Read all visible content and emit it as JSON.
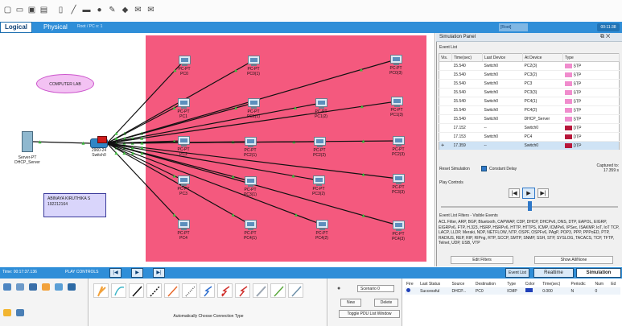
{
  "workspace": {
    "logical_tab": "Logical",
    "physical_tab": "Physical",
    "breadcrumb": "Root / PC o: 1",
    "root_label": "[Root]",
    "time_readout": "00:11:38"
  },
  "canvas": {
    "notes": {
      "lab": "COMPUTER LAB",
      "name_line1": "ABINAYA KIRUTHIKA S",
      "name_line2": "192212164"
    },
    "server": {
      "line1": "Server-PT",
      "line2": "DHCP_Server"
    },
    "switch": {
      "line1": "2960-24",
      "line2": "Switch0"
    },
    "pcs": [
      {
        "type": "PC-PT",
        "name": "PC0"
      },
      {
        "type": "PC-PT",
        "name": "PC0(1)"
      },
      {
        "type": "PC-PT",
        "name": "PC0(3)"
      },
      {
        "type": "PC-PT",
        "name": "PC1"
      },
      {
        "type": "PC-PT",
        "name": "PC1(1)"
      },
      {
        "type": "PC-PT",
        "name": "PC1(2)"
      },
      {
        "type": "PC-PT",
        "name": "PC1(3)"
      },
      {
        "type": "PC-PT",
        "name": "PC2"
      },
      {
        "type": "PC-PT",
        "name": "PC2(1)"
      },
      {
        "type": "PC-PT",
        "name": "PC2(2)"
      },
      {
        "type": "PC-PT",
        "name": "PC2(3)"
      },
      {
        "type": "PC-PT",
        "name": "PC3"
      },
      {
        "type": "PC-PT",
        "name": "PC3(1)"
      },
      {
        "type": "PC-PT",
        "name": "PC3(2)"
      },
      {
        "type": "PC-PT",
        "name": "PC3(3)"
      },
      {
        "type": "PC-PT",
        "name": "PC4"
      },
      {
        "type": "PC-PT",
        "name": "PC4(1)"
      },
      {
        "type": "PC-PT",
        "name": "PC4(2)"
      },
      {
        "type": "PC-PT",
        "name": "PC4(3)"
      }
    ],
    "cluster_color": "#f4597e"
  },
  "sim_panel": {
    "title": "Simulation Panel",
    "event_list_label": "Event List",
    "columns": [
      "Vis.",
      "Time(sec)",
      "Last Device",
      "At Device",
      "Type"
    ],
    "events": [
      {
        "vis": "",
        "time": "15.540",
        "last": "Switch0",
        "at": "PC2(3)",
        "type": "STP",
        "color": "#f08ccd"
      },
      {
        "vis": "",
        "time": "15.540",
        "last": "Switch0",
        "at": "PC3(2)",
        "type": "STP",
        "color": "#f08ccd"
      },
      {
        "vis": "",
        "time": "15.540",
        "last": "Switch0",
        "at": "PC3",
        "type": "STP",
        "color": "#f08ccd"
      },
      {
        "vis": "",
        "time": "15.540",
        "last": "Switch0",
        "at": "PC3(3)",
        "type": "STP",
        "color": "#f08ccd"
      },
      {
        "vis": "",
        "time": "15.540",
        "last": "Switch0",
        "at": "PC4(1)",
        "type": "STP",
        "color": "#f08ccd"
      },
      {
        "vis": "",
        "time": "15.540",
        "last": "Switch0",
        "at": "PC4(2)",
        "type": "STP",
        "color": "#f08ccd"
      },
      {
        "vis": "",
        "time": "15.540",
        "last": "Switch0",
        "at": "DHCP_Server",
        "type": "STP",
        "color": "#f08ccd"
      },
      {
        "vis": "",
        "time": "17.152",
        "last": "--",
        "at": "Switch0",
        "type": "DTP",
        "color": "#b7163a"
      },
      {
        "vis": "",
        "time": "17.153",
        "last": "Switch0",
        "at": "PC4",
        "type": "DTP",
        "color": "#b7163a"
      },
      {
        "vis": "✈",
        "time": "17.359",
        "last": "--",
        "at": "Switch0",
        "type": "DTP",
        "color": "#b7163a"
      }
    ],
    "reset_label": "Reset Simulation",
    "constant_delay_label": "Constant Delay",
    "captured_label": "Captured to:",
    "captured_value": "17.359 s",
    "play_controls_label": "Play Controls",
    "speed_fraction": 0.5,
    "filters_label": "Event List Filters - Visible Events",
    "filters_text": "ACL Filter, ARP, BGP, Bluetooth, CAPWAP, CDP, DHCP, DHCPv6, DNS, DTP, EAPOL, EIGRP, EIGRPv6, FTP, H.323, HSRP, HSRPv6, HTTP, HTTPS, ICMP, ICMPv6, IPSec, ISAKMP, IoT, IoT TCP, LACP, LLDP, Meraki, NDP, NETFLOW, NTP, OSPF, OSPFv6, PAgP, POP3, PPP, PPPoED, PTP, RADIUS, REP, RIP, RIPng, RTP, SCCP, SMTP, SNMP, SSH, STP, SYSLOG, TACACS, TCP, TFTP, Telnet, UDP, USB, VTP",
    "edit_filters": "Edit Filters",
    "show_all": "Show All/None"
  },
  "bottom_bar": {
    "time": "Time: 00:17:37.136",
    "play_controls": "PLAY CONTROLS",
    "event_list": "Event List",
    "realtime": "Realtime",
    "simulation": "Simulation"
  },
  "device_picker": {
    "caption": "Automatically Choose Connection Type"
  },
  "scenario": {
    "select": "Scenario 0",
    "new": "New",
    "delete": "Delete",
    "toggle": "Toggle PDU List Window"
  },
  "pdu_list": {
    "columns": [
      "Fire",
      "Last Status",
      "Source",
      "Destination",
      "Type",
      "Color",
      "Time(sec)",
      "Periodic",
      "Num",
      "Ed"
    ],
    "rows": [
      {
        "fire": "",
        "status": "Successful",
        "source": "DHCP...",
        "dest": "PC0",
        "type": "ICMP",
        "color": "#1f3fb8",
        "time": "0.000",
        "periodic": "N",
        "num": "0",
        "ed": ""
      }
    ]
  }
}
